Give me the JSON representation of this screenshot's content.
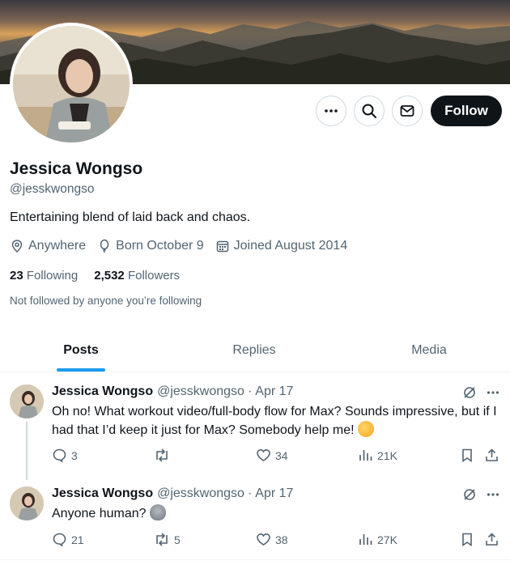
{
  "profile": {
    "name": "Jessica Wongso",
    "handle": "@jesskwongso",
    "bio": "Entertaining blend of laid back and chaos.",
    "location": "Anywhere",
    "birthday": "Born October 9",
    "joined": "Joined August 2014",
    "following_count": "23",
    "following_label": "Following",
    "followers_count": "2,532",
    "followers_label": "Followers",
    "not_followed_text": "Not followed by anyone you’re following"
  },
  "header_actions": {
    "more_icon": "more-dots-icon",
    "search_icon": "search-icon",
    "message_icon": "envelope-icon",
    "follow_label": "Follow"
  },
  "tabs": [
    {
      "label": "Posts",
      "active": true
    },
    {
      "label": "Replies",
      "active": false
    },
    {
      "label": "Media",
      "active": false
    }
  ],
  "posts": [
    {
      "name": "Jessica Wongso",
      "handle": "@jesskwongso",
      "dot": "·",
      "date": "Apr 17",
      "text": "Oh no! What workout video/full-body flow for Max? Sounds impressive, but if I had that I’d keep it just for Max? Somebody help me!",
      "emoji": "shushing-face-emoji",
      "replies": "3",
      "reposts": "",
      "likes": "34",
      "views": "21K"
    },
    {
      "name": "Jessica Wongso",
      "handle": "@jesskwongso",
      "dot": "·",
      "date": "Apr 17",
      "text": "Anyone human?",
      "emoji": "alien-emoji",
      "replies": "21",
      "reposts": "5",
      "likes": "38",
      "views": "27K"
    }
  ],
  "colors": {
    "accent": "#1d9bf0",
    "text_primary": "#0f1419",
    "text_secondary": "#536471",
    "follow_bg": "#0f1419"
  }
}
